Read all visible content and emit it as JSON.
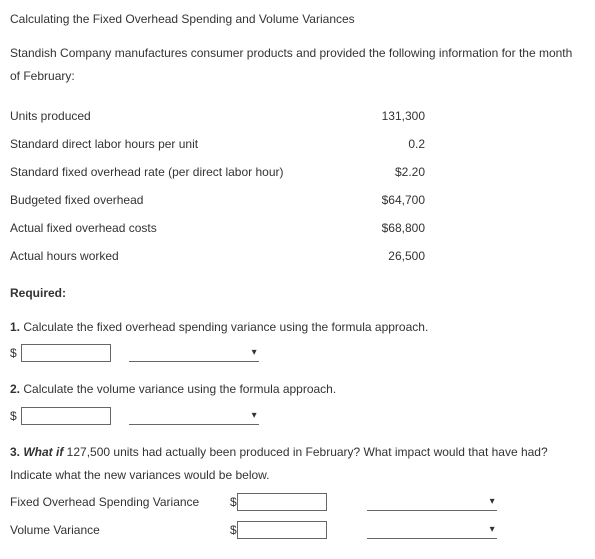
{
  "title": "Calculating the Fixed Overhead Spending and Volume Variances",
  "intro": "Standish Company manufactures consumer products and provided the following information for the month of February:",
  "rows": [
    {
      "label": "Units produced",
      "value": "131,300"
    },
    {
      "label": "Standard direct labor hours per unit",
      "value": "0.2"
    },
    {
      "label": "Standard fixed overhead rate (per direct labor hour)",
      "value": "$2.20"
    },
    {
      "label": "Budgeted fixed overhead",
      "value": "$64,700"
    },
    {
      "label": "Actual fixed overhead costs",
      "value": "$68,800"
    },
    {
      "label": "Actual hours worked",
      "value": "26,500"
    }
  ],
  "required": "Required:",
  "q1": {
    "num": "1.",
    "text": " Calculate the fixed overhead spending variance using the formula approach."
  },
  "q2": {
    "num": "2.",
    "text": " Calculate the volume variance using the formula approach."
  },
  "q3": {
    "num": "3.",
    "lead": " What if",
    "text": " 127,500 units had actually been produced in February? What impact would that have had? Indicate what the new variances would be below."
  },
  "q3rows": {
    "spend": "Fixed Overhead Spending Variance",
    "vol": "Volume Variance"
  },
  "dollar": "$"
}
